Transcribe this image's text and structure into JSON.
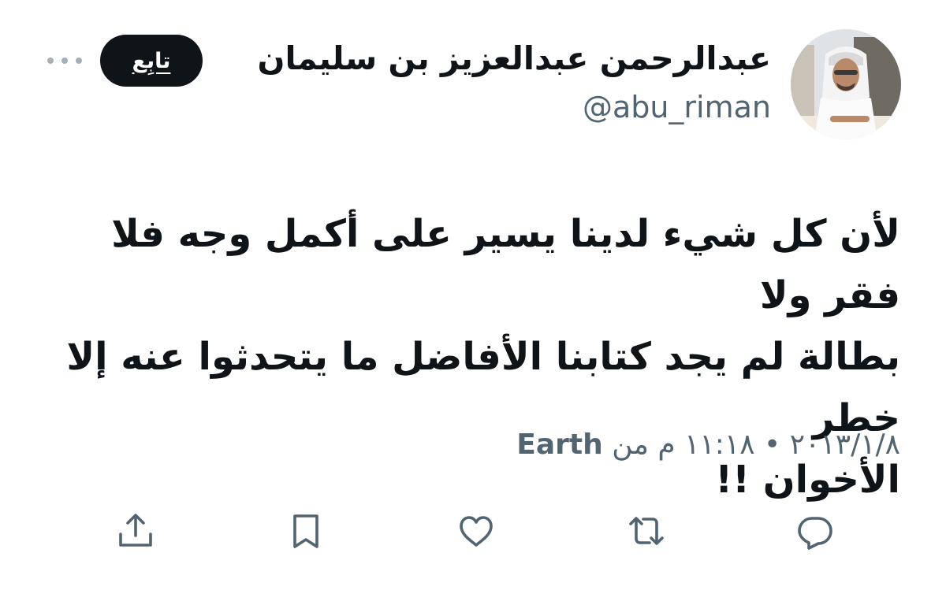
{
  "user": {
    "display_name": "عبدالرحمن عبدالعزيز بن سليمان",
    "handle": "@abu_riman"
  },
  "header": {
    "follow_label": "تابِع",
    "more_icon": "more-horizontal-icon"
  },
  "tweet": {
    "text": "لأن كل شيء لدينا يسير على أكمل وجه فلا فقر ولا\nبطالة لم يجد كتابنا الأفاضل ما يتحدثوا عنه إلا خطر\nالأخوان !!",
    "date": "٢٠١٣/١/٨",
    "separator": "•",
    "time": "١١:١٨ م",
    "from_label": "من",
    "source": "Earth"
  },
  "actions": [
    {
      "name": "reply",
      "icon": "reply-icon"
    },
    {
      "name": "retweet",
      "icon": "retweet-icon"
    },
    {
      "name": "like",
      "icon": "heart-icon"
    },
    {
      "name": "bookmark",
      "icon": "bookmark-icon"
    },
    {
      "name": "share",
      "icon": "share-icon"
    }
  ],
  "colors": {
    "text_primary": "#0f1419",
    "text_secondary": "#536471",
    "button_bg": "#0f1419",
    "icon": "#536471"
  }
}
